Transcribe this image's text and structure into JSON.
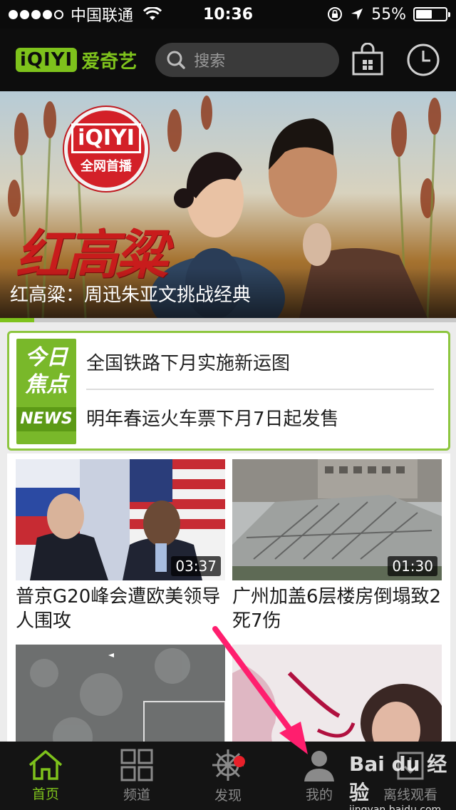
{
  "status_bar": {
    "carrier": "中国联通",
    "time": "10:36",
    "battery": "55%",
    "battery_level": 0.55
  },
  "header": {
    "logo_mark": "iQIYI",
    "logo_text": "爱奇艺",
    "search_placeholder": "搜索",
    "icons": [
      "search-icon",
      "store-icon",
      "history-clock-icon"
    ]
  },
  "banner": {
    "badge_logo": "iQIYI",
    "badge_text": "全网首播",
    "title_art": "红高粱",
    "caption": "红高粱：周迅朱亚文挑战经典",
    "carousel_progress": 0.075
  },
  "focus": {
    "tag_line1": "今日",
    "tag_line2": "焦点",
    "tag_line3": "NEWS",
    "headlines": [
      "全国铁路下月实施新运图",
      "明年春运火车票下月7日起发售"
    ]
  },
  "videos": [
    {
      "title": "普京G20峰会遭欧美领导人围攻",
      "duration": "03:37"
    },
    {
      "title": "广州加盖6层楼房倒塌致2死7伤",
      "duration": "01:30"
    },
    {
      "title": "",
      "duration": ""
    },
    {
      "title": "",
      "duration": ""
    }
  ],
  "tabbar": {
    "tabs": [
      {
        "label": "首页",
        "icon": "home-icon",
        "active": true
      },
      {
        "label": "频道",
        "icon": "grid-icon"
      },
      {
        "label": "发现",
        "icon": "helm-icon",
        "badge": true
      },
      {
        "label": "我的",
        "icon": "user-icon"
      },
      {
        "label": "离线观看",
        "icon": "download-icon"
      }
    ]
  },
  "colors": {
    "accent": "#7ec21c",
    "header_bg": "#0d0d0d",
    "badge_red": "#d32028",
    "arrow_pink": "#ff1e6e"
  },
  "watermark": {
    "line1": "Bai du 经验",
    "line2": "jingyan.baidu.com"
  }
}
